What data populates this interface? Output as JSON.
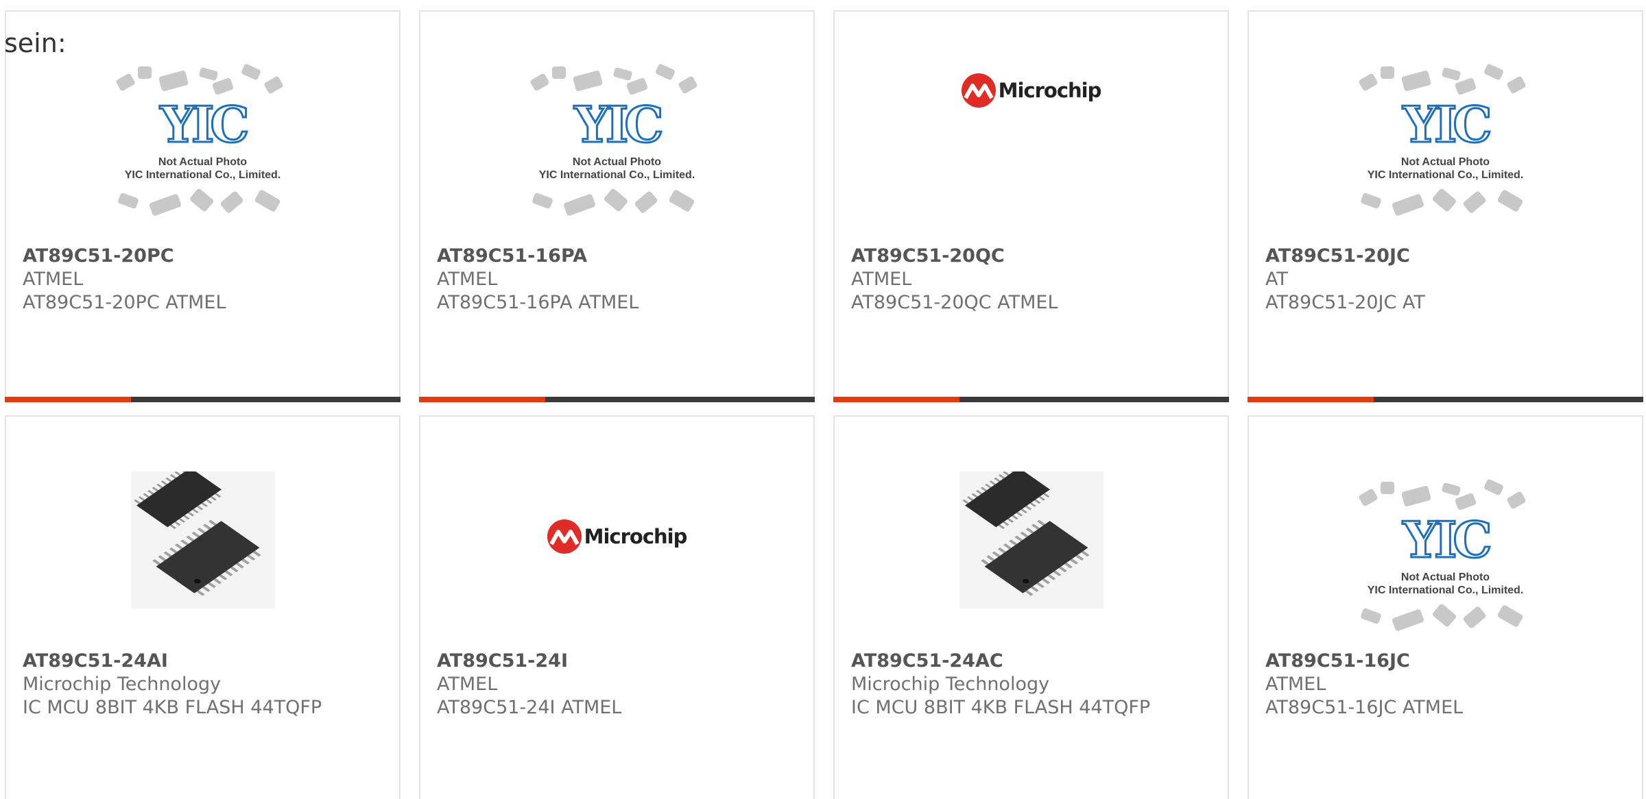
{
  "lead_text": "sein:",
  "products": [
    {
      "part": "AT89C51-20PC",
      "manufacturer": "ATMEL",
      "description": "AT89C51-20PC ATMEL",
      "image": "yic-placeholder",
      "placeholder_line1": "Not Actual Photo",
      "placeholder_line2": "YIC International Co., Limited."
    },
    {
      "part": "AT89C51-16PA",
      "manufacturer": "ATMEL",
      "description": "AT89C51-16PA ATMEL",
      "image": "yic-placeholder",
      "placeholder_line1": "Not Actual Photo",
      "placeholder_line2": "YIC International Co., Limited."
    },
    {
      "part": "AT89C51-20QC",
      "manufacturer": "ATMEL",
      "description": "AT89C51-20QC ATMEL",
      "image": "microchip-logo",
      "logo_text": "Microchip"
    },
    {
      "part": "AT89C51-20JC",
      "manufacturer": "AT",
      "description": "AT89C51-20JC AT",
      "image": "yic-placeholder",
      "placeholder_line1": "Not Actual Photo",
      "placeholder_line2": "YIC International Co., Limited."
    },
    {
      "part": "AT89C51-24AI",
      "manufacturer": "Microchip Technology",
      "description": "IC MCU 8BIT 4KB FLASH 44TQFP",
      "image": "tqfp-chip-photo"
    },
    {
      "part": "AT89C51-24I",
      "manufacturer": "ATMEL",
      "description": "AT89C51-24I ATMEL",
      "image": "microchip-logo",
      "logo_text": "Microchip"
    },
    {
      "part": "AT89C51-24AC",
      "manufacturer": "Microchip Technology",
      "description": "IC MCU 8BIT 4KB FLASH 44TQFP",
      "image": "tqfp-chip-photo"
    },
    {
      "part": "AT89C51-16JC",
      "manufacturer": "ATMEL",
      "description": "AT89C51-16JC ATMEL",
      "image": "yic-placeholder",
      "placeholder_line1": "Not Actual Photo",
      "placeholder_line2": "YIC International Co., Limited."
    }
  ],
  "colors": {
    "accent": "#e8380d",
    "bar": "#3a3a3a",
    "yic_blue": "#1a6fc0",
    "microchip_red": "#e02b27"
  }
}
